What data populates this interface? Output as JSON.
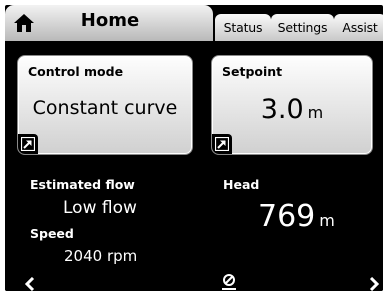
{
  "tabs": {
    "home": "Home",
    "status": "Status",
    "settings": "Settings",
    "assist": "Assist"
  },
  "control_mode": {
    "title": "Control mode",
    "value": "Constant curve"
  },
  "setpoint": {
    "title": "Setpoint",
    "value": "3.0",
    "unit": "m"
  },
  "estimated_flow": {
    "label": "Estimated flow",
    "value": "Low flow"
  },
  "speed": {
    "label": "Speed",
    "value": "2040 rpm"
  },
  "head": {
    "label": "Head",
    "value": "769",
    "unit": "m"
  },
  "icons": [
    "home-icon",
    "edit-arrow-icon",
    "nav-left-icon",
    "nav-right-icon",
    "position-icon"
  ],
  "colors": {
    "background": "#000000",
    "card": "#e6e6e6",
    "text_light": "#ffffff"
  }
}
